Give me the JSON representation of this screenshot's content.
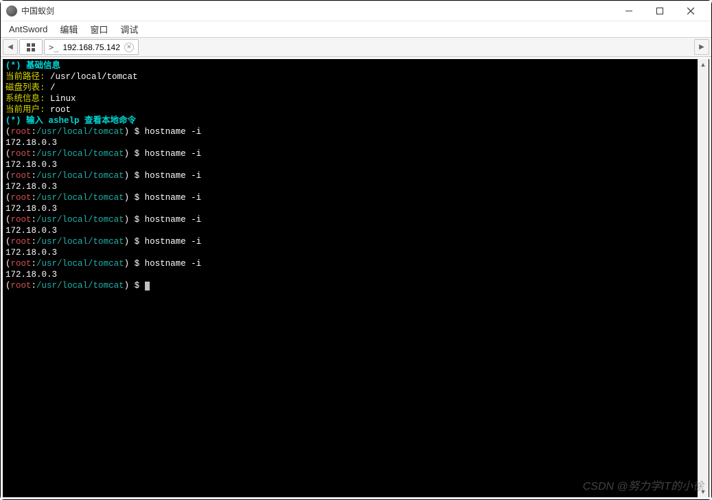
{
  "window": {
    "title": "中国蚁剑"
  },
  "menubar": {
    "items": [
      "AntSword",
      "编辑",
      "窗口",
      "调试"
    ]
  },
  "tabbar": {
    "nav_left": "◀",
    "nav_right": "▶",
    "tab": {
      "prompt": ">_",
      "label": "192.168.75.142"
    }
  },
  "terminal": {
    "section_basic": "(*) 基础信息",
    "info": {
      "path_label": "当前路径:",
      "path_value": "/usr/local/tomcat",
      "disk_label": "磁盘列表:",
      "disk_value": "/",
      "sys_label": "系统信息:",
      "sys_value": "Linux",
      "user_label": "当前用户:",
      "user_value": "root"
    },
    "section_help": "(*) 输入 ashelp 查看本地命令",
    "prompt_user": "root",
    "prompt_sep": ":",
    "prompt_path": "/usr/local/tomcat",
    "prompt_dollar": "$",
    "command": "hostname -i",
    "output": "172.18.0.3",
    "repeat_count": 7
  },
  "watermark": "CSDN @努力学IT的小徐"
}
